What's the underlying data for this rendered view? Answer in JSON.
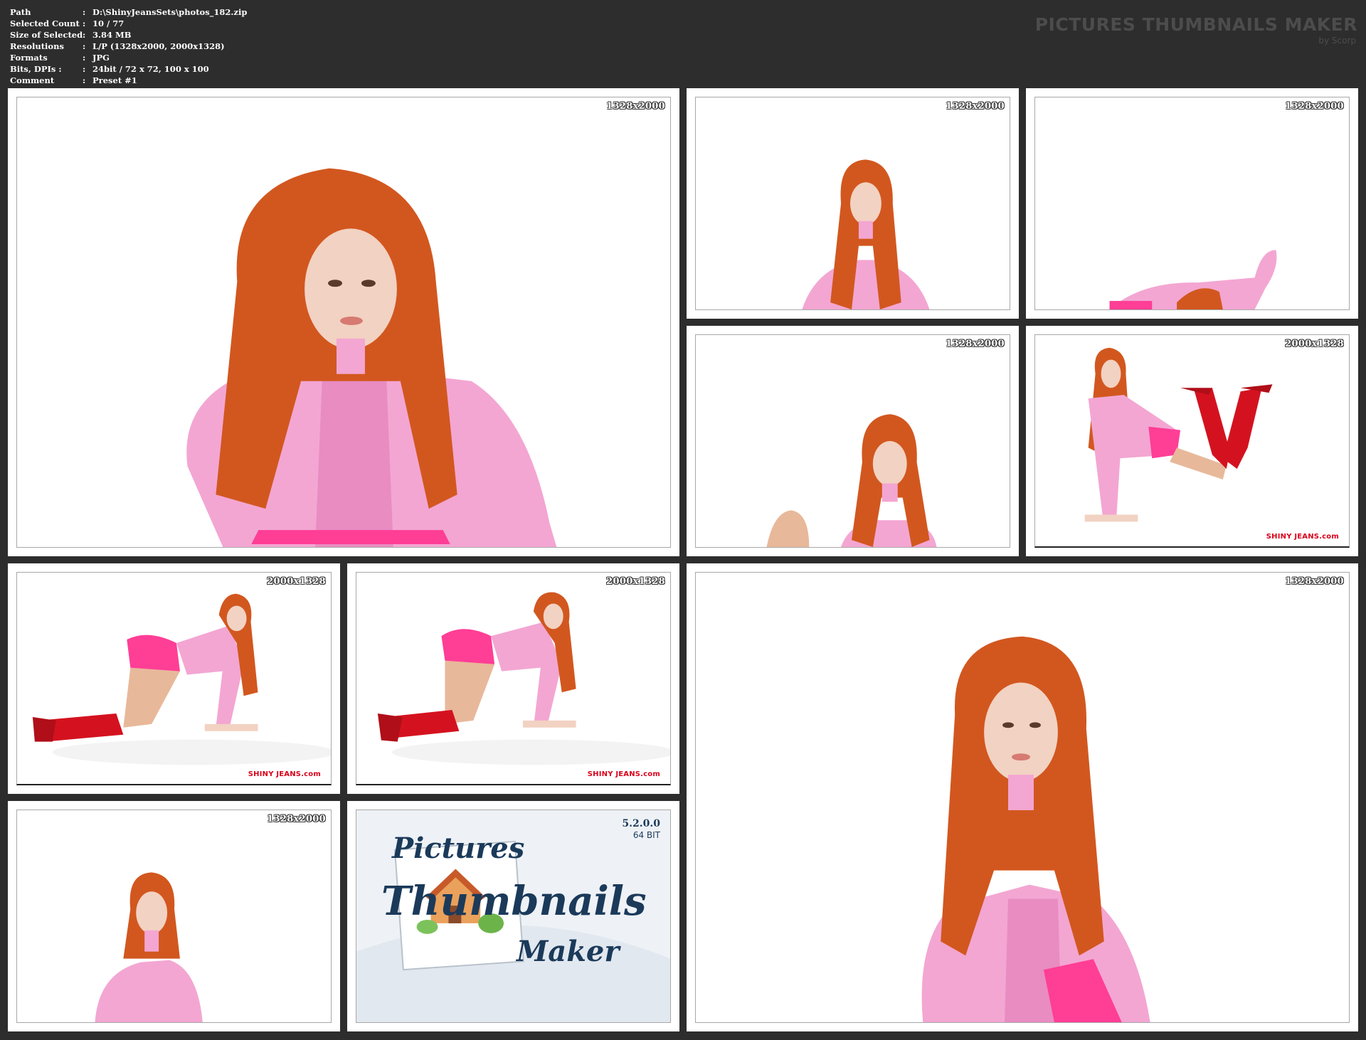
{
  "info": {
    "rows": [
      {
        "label": "Path",
        "sep": ":",
        "value": "D:\\ShinyJeansSets\\photos_182.zip"
      },
      {
        "label": "Selected Count",
        "sep": ":",
        "value": "10 / 77"
      },
      {
        "label": "Size of Selected",
        "sep": ":",
        "value": "3.84 MB"
      },
      {
        "label": "Resolutions",
        "sep": ":",
        "value": "L/P (1328x2000, 2000x1328)"
      },
      {
        "label": "Formats",
        "sep": ":",
        "value": "JPG"
      },
      {
        "label": "Bits, DPIs :",
        "sep": ":",
        "value": "24bit / 72 x 72, 100 x 100"
      },
      {
        "label": "Comment",
        "sep": ":",
        "value": "Preset #1"
      }
    ]
  },
  "brand": {
    "title": "PICTURES THUMBNAILS MAKER",
    "subtitle": "by Scorp"
  },
  "thumbnails": [
    {
      "resolution": "1328x2000"
    },
    {
      "resolution": "1328x2000"
    },
    {
      "resolution": "1328x2000"
    },
    {
      "resolution": "1328x2000"
    },
    {
      "resolution": "2000x1328",
      "watermark": "SHINY JEANS.com"
    },
    {
      "resolution": "2000x1328",
      "watermark": "SHINY JEANS.com"
    },
    {
      "resolution": "2000x1328",
      "watermark": "SHINY JEANS.com"
    },
    {
      "resolution": "1328x2000"
    },
    {
      "resolution": "1328x2000"
    }
  ],
  "logo": {
    "version": "5.2.0.0",
    "bits": "64 BIT",
    "word1": "Pictures",
    "word2": "Thumbnails",
    "word3": "Maker"
  },
  "colors": {
    "background": "#2d2d2d",
    "frame": "#ffffff",
    "bodysuit": "#f3a6d2",
    "hair": "#d2571f",
    "boots": "#d4121f",
    "accent_pink": "#ff3e96"
  }
}
